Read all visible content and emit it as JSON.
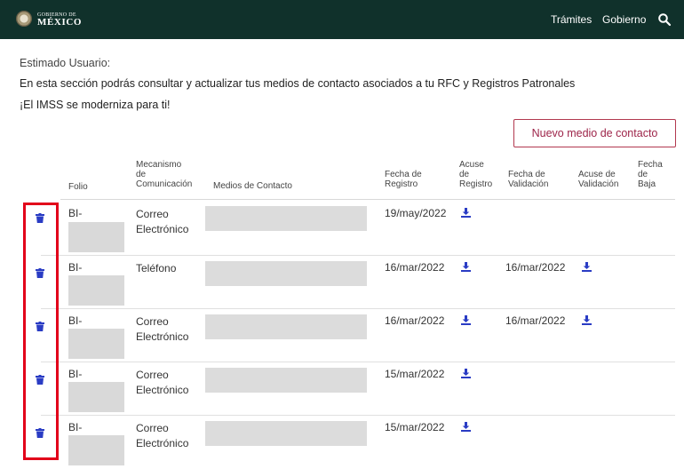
{
  "header": {
    "logo_small": "GOBIERNO DE",
    "logo_big": "MÉXICO",
    "nav_tramites": "Trámites",
    "nav_gobierno": "Gobierno",
    "icon": "search-icon",
    "bg_color": "#10312b"
  },
  "intro": {
    "greeting": "Estimado Usuario:",
    "description": "En esta sección podrás consultar y actualizar tus medios de contacto asociados a tu RFC y Registros Patronales",
    "tagline": "¡El IMSS se moderniza para ti!"
  },
  "new_contact_button": "Nuevo medio de contacto",
  "table": {
    "headers": {
      "folio": "Folio",
      "mecanismo_1": "Mecanismo",
      "mecanismo_2": "de",
      "mecanismo_3": "Comunicación",
      "medios": "Medios de Contacto",
      "fecha_registro_1": "Fecha de",
      "fecha_registro_2": "Registro",
      "acuse_registro_1": "Acuse",
      "acuse_registro_2": "de",
      "acuse_registro_3": "Registro",
      "fecha_validacion_1": "Fecha de",
      "fecha_validacion_2": "Validación",
      "acuse_validacion_1": "Acuse de",
      "acuse_validacion_2": "Validación",
      "fecha_baja_1": "Fecha",
      "fecha_baja_2": "de",
      "fecha_baja_3": "Baja"
    },
    "rows": [
      {
        "folio": "BI-",
        "mecanismo_1": "Correo",
        "mecanismo_2": "Electrónico",
        "fecha_registro": "19/may/2022",
        "fecha_validacion": ""
      },
      {
        "folio": "BI-",
        "mecanismo_1": "Teléfono",
        "mecanismo_2": "",
        "fecha_registro": "16/mar/2022",
        "fecha_validacion": "16/mar/2022"
      },
      {
        "folio": "BI-",
        "mecanismo_1": "Correo",
        "mecanismo_2": "Electrónico",
        "fecha_registro": "16/mar/2022",
        "fecha_validacion": "16/mar/2022"
      },
      {
        "folio": "BI-",
        "mecanismo_1": "Correo",
        "mecanismo_2": "Electrónico",
        "fecha_registro": "15/mar/2022",
        "fecha_validacion": ""
      },
      {
        "folio": "BI-",
        "mecanismo_1": "Correo",
        "mecanismo_2": "Electrónico",
        "fecha_registro": "15/mar/2022",
        "fecha_validacion": ""
      }
    ],
    "icons": {
      "delete": "trash-icon",
      "download": "download-icon"
    },
    "accent_color": "#9d2449",
    "icon_color": "#2a3cc4",
    "highlight_color": "#e2001a"
  }
}
